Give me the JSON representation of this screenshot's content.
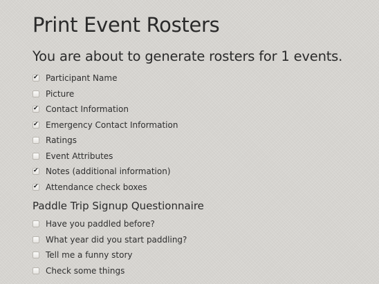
{
  "page": {
    "title": "Print Event Rosters",
    "subtitle": "You are about to generate rosters for 1 events."
  },
  "roster_options": [
    {
      "label": "Participant Name",
      "checked": true
    },
    {
      "label": "Picture",
      "checked": false
    },
    {
      "label": "Contact Information",
      "checked": true
    },
    {
      "label": "Emergency Contact Information",
      "checked": true
    },
    {
      "label": "Ratings",
      "checked": false
    },
    {
      "label": "Event Attributes",
      "checked": false
    },
    {
      "label": "Notes (additional information)",
      "checked": true
    },
    {
      "label": "Attendance check boxes",
      "checked": true
    }
  ],
  "questionnaire": {
    "title": "Paddle Trip Signup Questionnaire",
    "options": [
      {
        "label": "Have you paddled before?",
        "checked": false
      },
      {
        "label": "What year did you start paddling?",
        "checked": false
      },
      {
        "label": "Tell me a funny story",
        "checked": false
      },
      {
        "label": "Check some things",
        "checked": false
      }
    ]
  }
}
